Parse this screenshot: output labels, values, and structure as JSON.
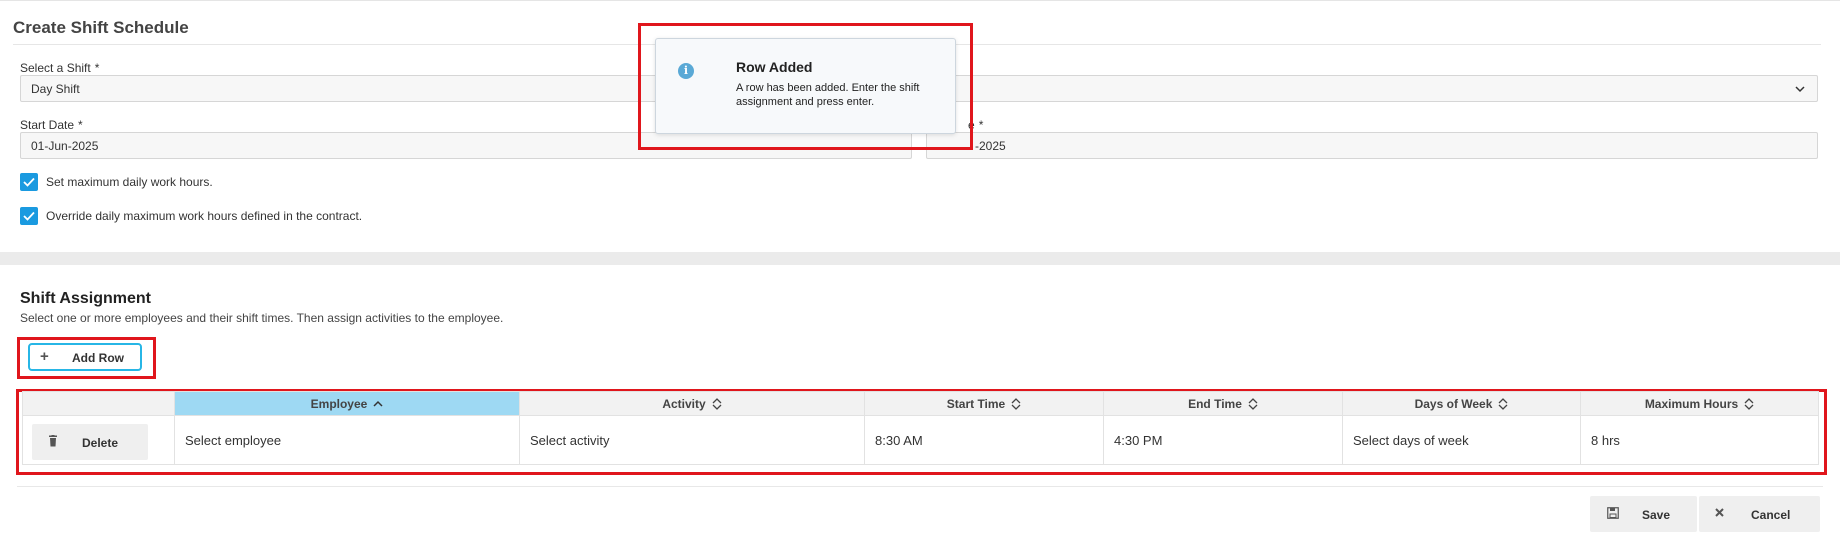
{
  "page": {
    "title": "Create Shift Schedule"
  },
  "form": {
    "shift": {
      "label": "Select a Shift",
      "required_mark": "*",
      "value": "Day Shift"
    },
    "start_date": {
      "label": "Start Date",
      "required_mark": "*",
      "value": "01-Jun-2025"
    },
    "end_date": {
      "label_visible": "e",
      "required_mark": "*",
      "value_visible": "-2025"
    },
    "checkboxes": [
      {
        "label": "Set maximum daily work hours.",
        "checked": true
      },
      {
        "label": "Override daily maximum work hours defined in the contract.",
        "checked": true
      }
    ]
  },
  "assignment": {
    "title": "Shift Assignment",
    "description": "Select one or more employees and their shift times. Then assign activities to the employee.",
    "add_row_label": "Add Row",
    "columns": [
      {
        "label": "Employee",
        "sorted": "asc"
      },
      {
        "label": "Activity"
      },
      {
        "label": "Start Time"
      },
      {
        "label": "End Time"
      },
      {
        "label": "Days of Week"
      },
      {
        "label": "Maximum Hours"
      }
    ],
    "rows": [
      {
        "delete_label": "Delete",
        "employee": "Select employee",
        "activity": "Select activity",
        "start_time": "8:30 AM",
        "end_time": "4:30 PM",
        "days_of_week": "Select days of week",
        "max_hours": "8 hrs"
      }
    ]
  },
  "footer": {
    "save_label": "Save",
    "cancel_label": "Cancel"
  },
  "toast": {
    "title": "Row Added",
    "message": "A row has been added. Enter the shift assignment and press enter."
  },
  "colors": {
    "accent": "#1a9ae0",
    "highlight": "#e0161c",
    "sorted_header": "#9ed9f3"
  }
}
